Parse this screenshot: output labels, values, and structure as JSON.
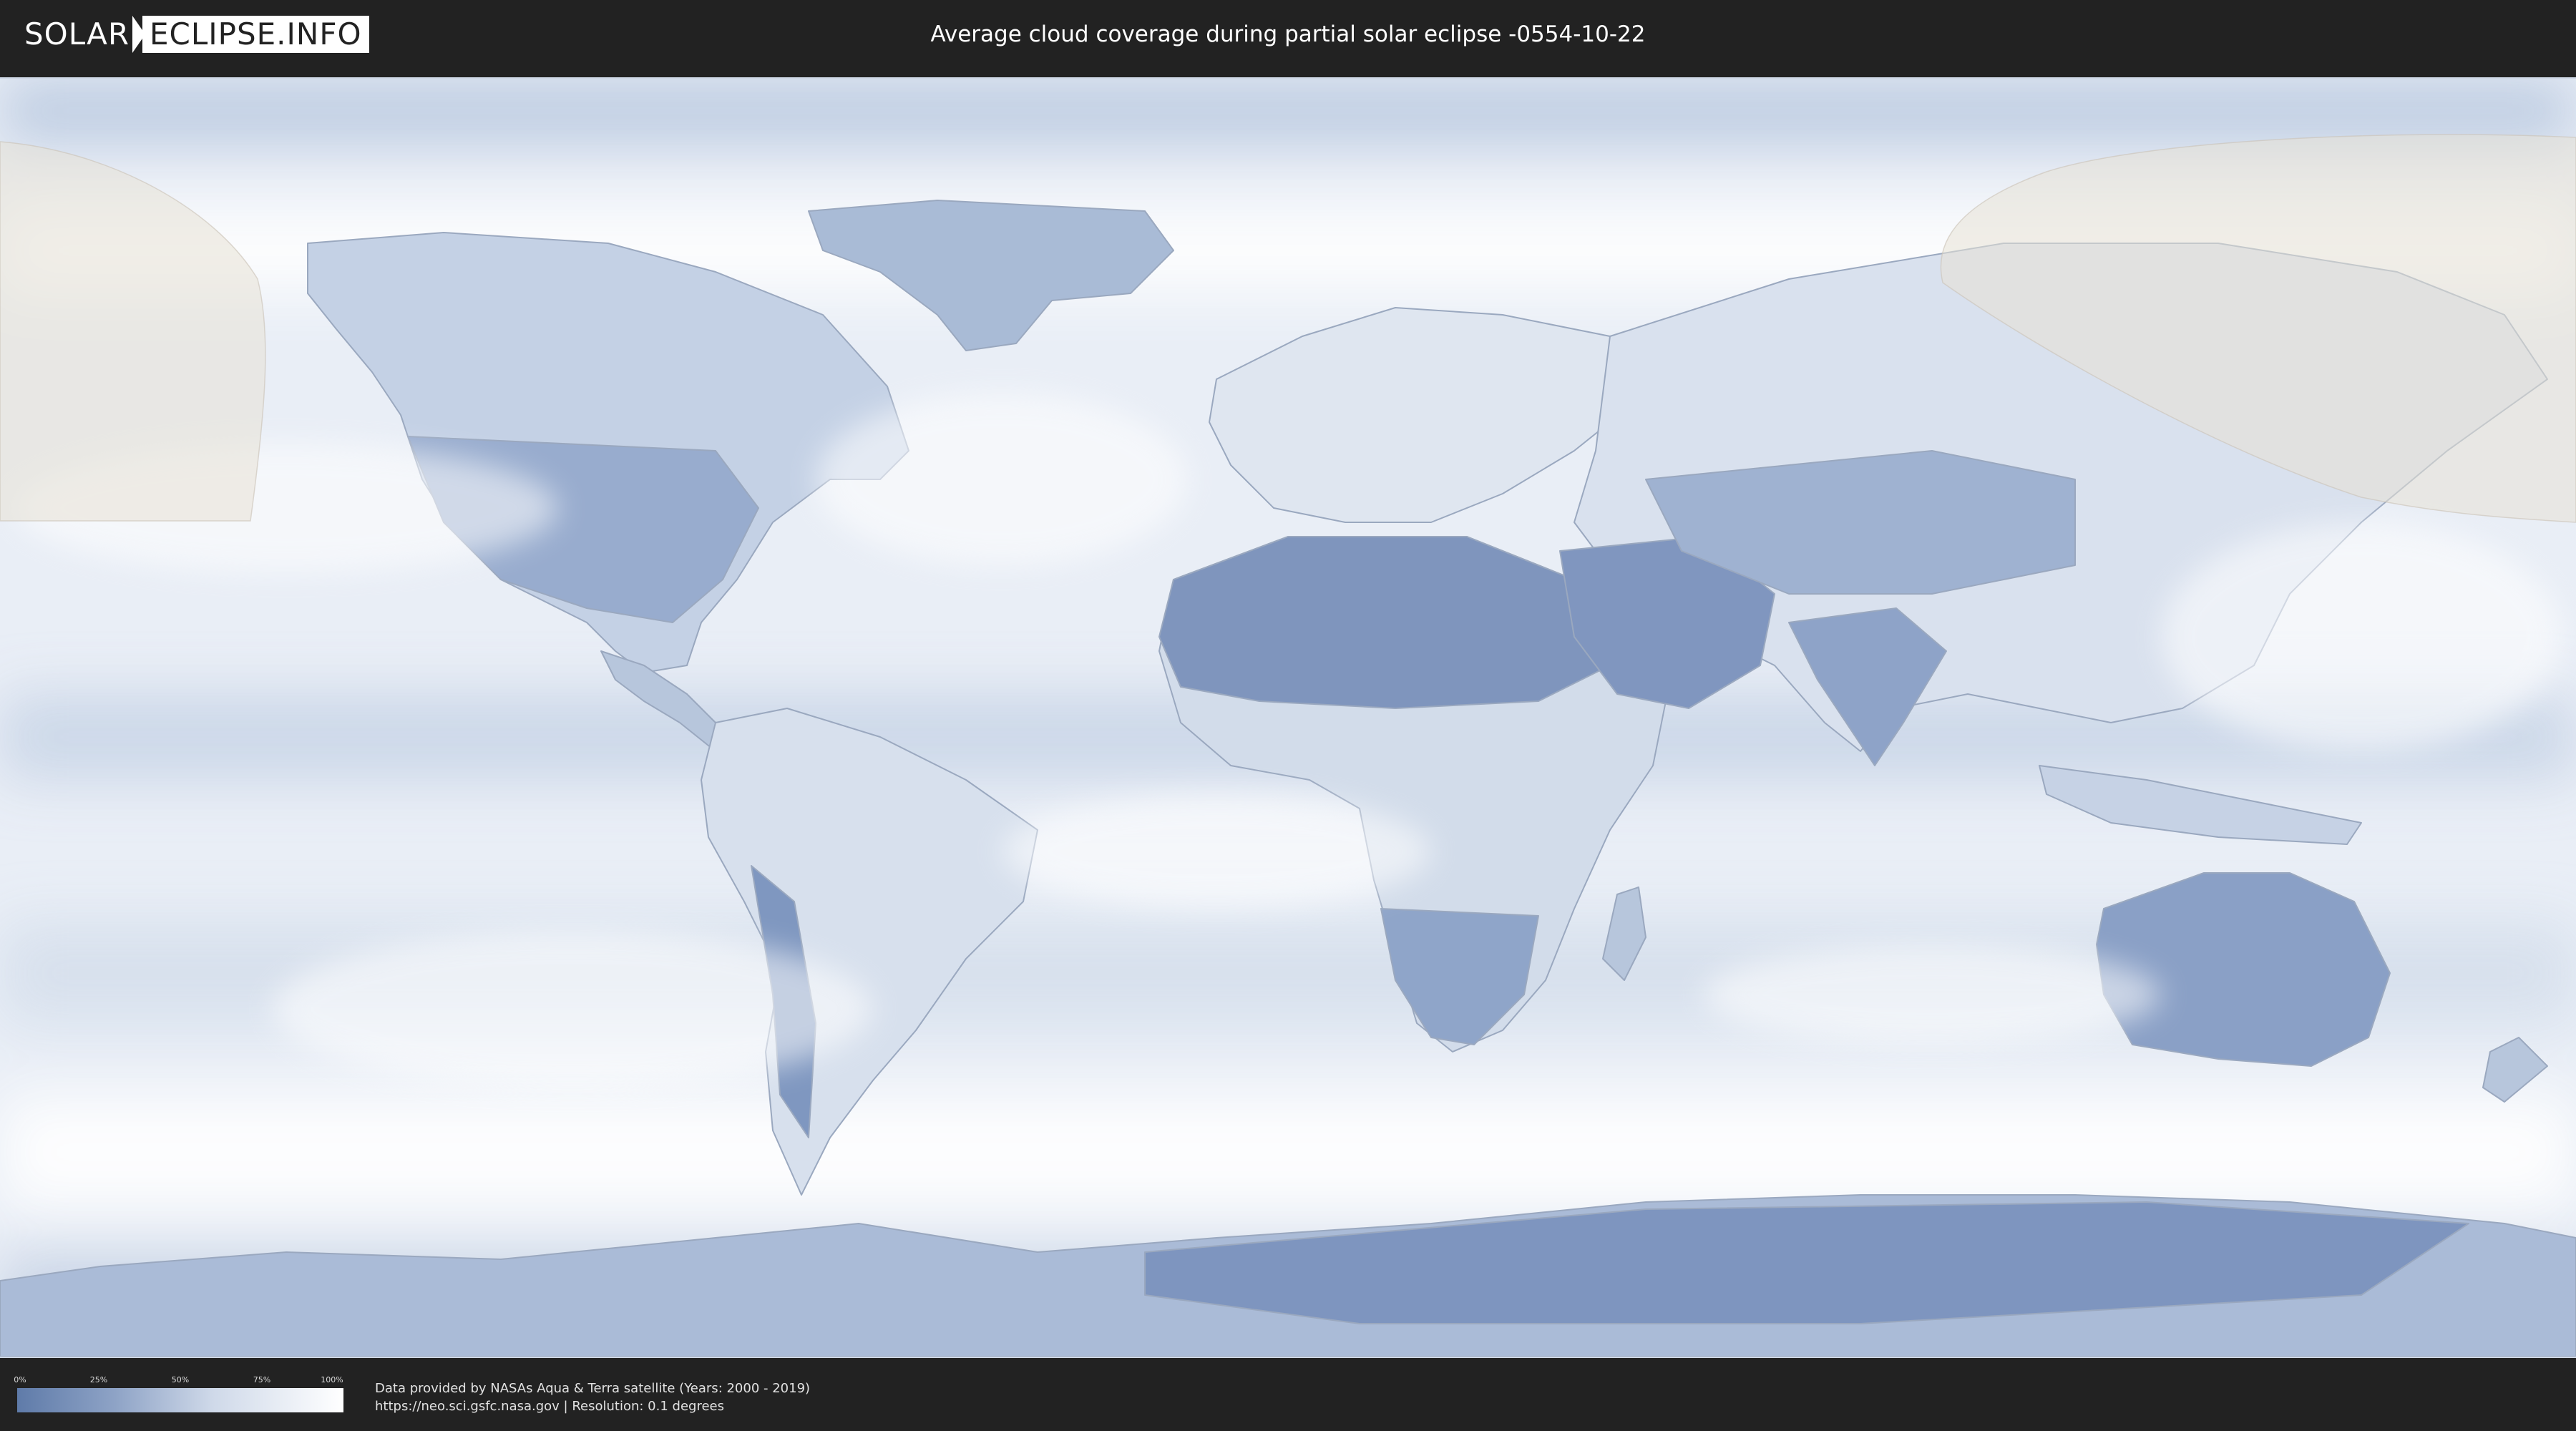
{
  "header": {
    "logo_left": "SOLAR",
    "logo_right": "ECLIPSE.INFO",
    "title": "Average cloud coverage during partial solar eclipse -0554-10-22"
  },
  "legend": {
    "ticks": [
      "0%",
      "25%",
      "50%",
      "75%",
      "100%"
    ],
    "colors": {
      "low": "#5f7ba9",
      "mid": "#cfd9e9",
      "high": "#ffffff"
    }
  },
  "credits": {
    "line1": "Data provided by NASAs Aqua & Terra satellite (Years: 2000 - 2019)",
    "line2": "https://neo.sci.gsfc.nasa.gov | Resolution: 0.1 degrees"
  },
  "map": {
    "type": "equirectangular-world-cloud-coverage",
    "eclipse_shadow_color": "#e8e1d6"
  }
}
